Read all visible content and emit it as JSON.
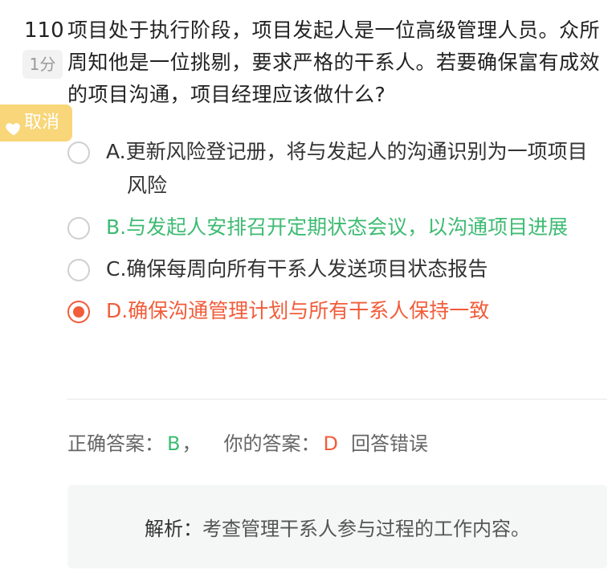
{
  "question": {
    "number": "110",
    "score": "1分",
    "text": "项目处于执行阶段，项目发起人是一位高级管理人员。众所周知他是一位挑剔，要求严格的干系人。若要确保富有成效的项目沟通，项目经理应该做什么?"
  },
  "favorite": {
    "label": "取消",
    "icon": "heart-icon"
  },
  "options": [
    {
      "label": "A.更新风险登记册，将与发起人的沟通识别为一项项目风险",
      "state": "normal"
    },
    {
      "label": "B.与发起人安排召开定期状态会议，以沟通项目进展",
      "state": "correct"
    },
    {
      "label": "C.确保每周向所有干系人发送项目状态报告",
      "state": "normal"
    },
    {
      "label": "D.确保沟通管理计划与所有干系人保持一致",
      "state": "selected-wrong"
    }
  ],
  "result": {
    "correct_label": "正确答案：",
    "correct_value": "B",
    "separator": "，",
    "mine_label": "你的答案：",
    "mine_value": "D",
    "verdict": "回答错误"
  },
  "explanation": {
    "label": "解析：",
    "text": "考查管理干系人参与过程的工作内容。"
  },
  "colors": {
    "correct": "#3dbb72",
    "wrong": "#f15c3a",
    "favorite_bg": "#f8d679"
  }
}
